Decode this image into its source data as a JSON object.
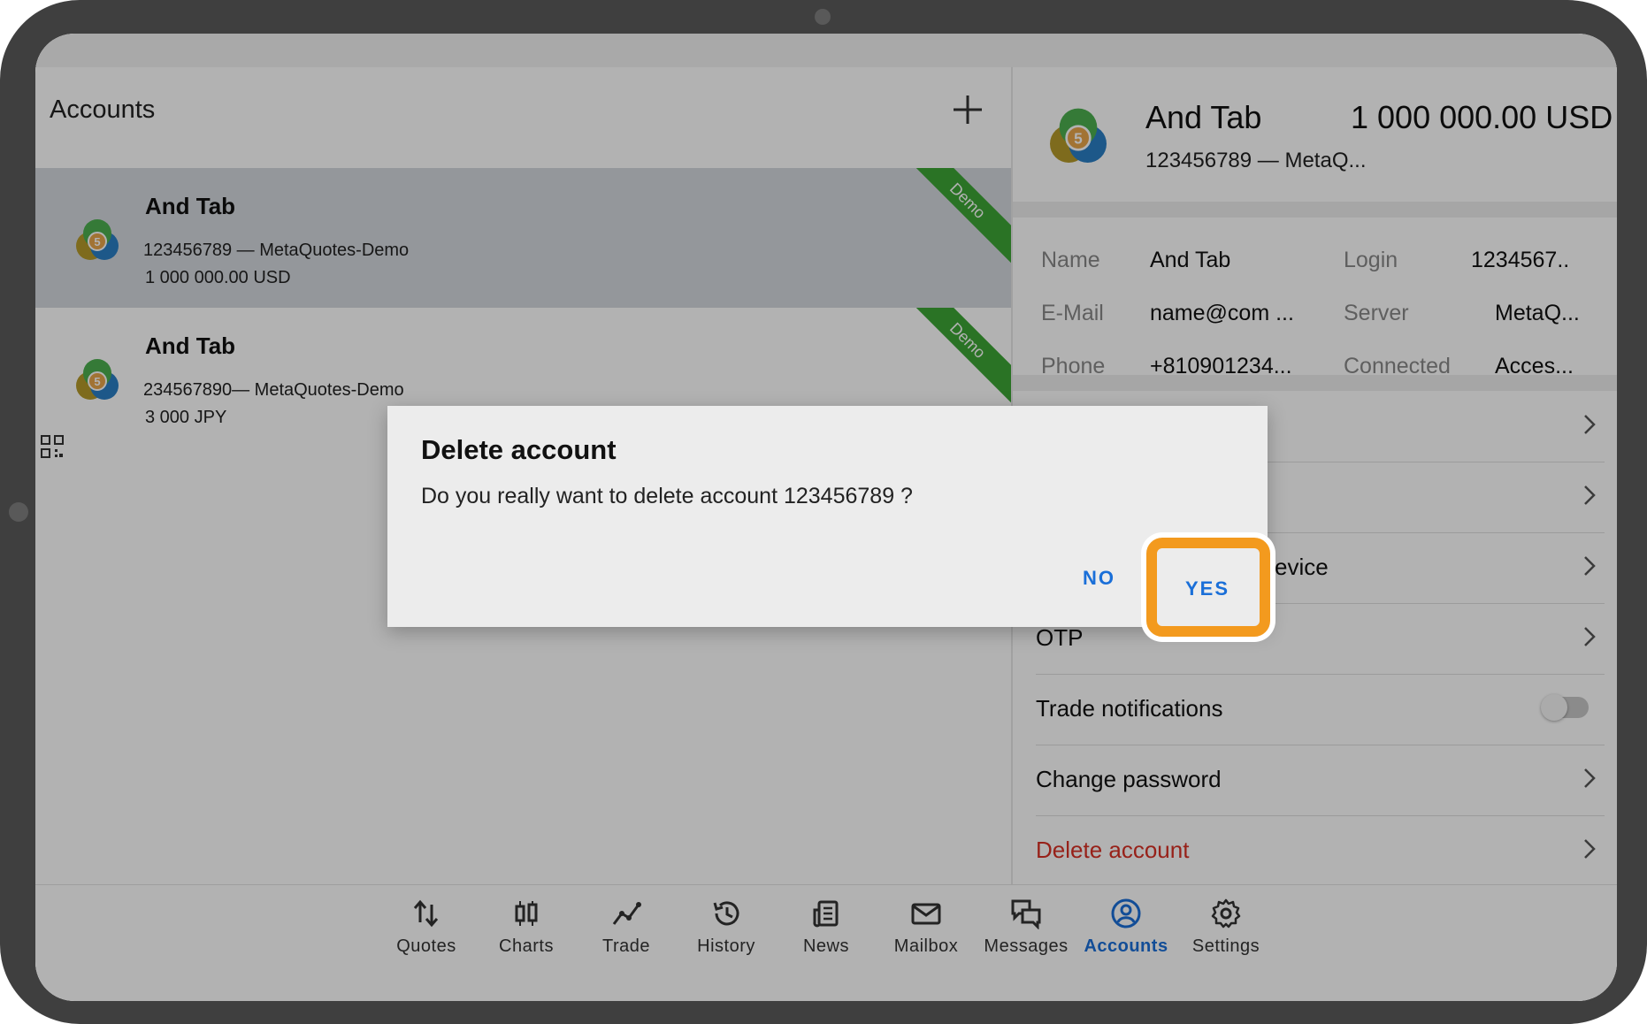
{
  "accounts_panel": {
    "title": "Accounts",
    "items": [
      {
        "name": "And Tab",
        "line1": "123456789 — MetaQuotes-Demo",
        "line2": "1 000 000.00 USD",
        "badge": "Demo"
      },
      {
        "name": "And Tab",
        "line1": "234567890— MetaQuotes-Demo",
        "line2": "3 000 JPY",
        "badge": "Demo"
      }
    ]
  },
  "account_detail": {
    "name": "And Tab",
    "balance": "1 000 000.00 USD",
    "subtitle": "123456789 — MetaQ...",
    "fields": {
      "name_label": "Name",
      "name_value": "And Tab",
      "login_label": "Login",
      "login_value": "1234567..",
      "email_label": "E-Mail",
      "email_value": "name@com  ...",
      "server_label": "Server",
      "server_value": "MetaQ...",
      "phone_label": "Phone",
      "phone_value": "+810901234...",
      "connected_label": "Connected",
      "connected_value": "Acces..."
    },
    "menu": {
      "item3_partial": "evice",
      "otp": "OTP",
      "trade_notifications": "Trade notifications",
      "trade_notifications_on": false,
      "change_password": "Change password",
      "delete_account": "Delete account"
    }
  },
  "dialog": {
    "title": "Delete account",
    "message": "Do you really want to delete account 123456789 ?",
    "no_label": "NO",
    "yes_label": "YES"
  },
  "bottom_nav": [
    {
      "label": "Quotes",
      "icon": "quotes-icon"
    },
    {
      "label": "Charts",
      "icon": "charts-icon"
    },
    {
      "label": "Trade",
      "icon": "trade-icon"
    },
    {
      "label": "History",
      "icon": "history-icon"
    },
    {
      "label": "News",
      "icon": "news-icon"
    },
    {
      "label": "Mailbox",
      "icon": "mailbox-icon"
    },
    {
      "label": "Messages",
      "icon": "messages-icon"
    },
    {
      "label": "Accounts",
      "icon": "accounts-icon",
      "active": true
    },
    {
      "label": "Settings",
      "icon": "settings-icon"
    }
  ],
  "colors": {
    "accent": "#1a6fd8",
    "highlight": "#f39a1e",
    "demo_badge": "#3da536",
    "danger": "#d93025"
  }
}
